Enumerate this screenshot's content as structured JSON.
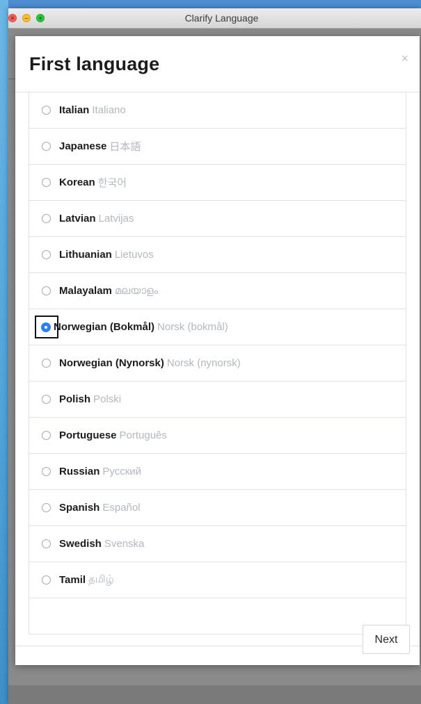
{
  "window": {
    "title": "Clarify Language",
    "traffic_glyphs": {
      "close": "×",
      "minimize": "–",
      "maximize": "+"
    }
  },
  "modal": {
    "title": "First language",
    "close_glyph": "×",
    "next_label": "Next"
  },
  "languages": [
    {
      "name": "Italian",
      "native": "Italiano",
      "selected": false
    },
    {
      "name": "Japanese",
      "native": "日本語",
      "selected": false
    },
    {
      "name": "Korean",
      "native": "한국어",
      "selected": false
    },
    {
      "name": "Latvian",
      "native": "Latvijas",
      "selected": false
    },
    {
      "name": "Lithuanian",
      "native": "Lietuvos",
      "selected": false
    },
    {
      "name": "Malayalam",
      "native": "മലയാളം",
      "selected": false
    },
    {
      "name": "Norwegian (Bokmål)",
      "native": "Norsk (bokmål)",
      "selected": true
    },
    {
      "name": "Norwegian (Nynorsk)",
      "native": "Norsk (nynorsk)",
      "selected": false
    },
    {
      "name": "Polish",
      "native": "Polski",
      "selected": false
    },
    {
      "name": "Portuguese",
      "native": "Português",
      "selected": false
    },
    {
      "name": "Russian",
      "native": "Русский",
      "selected": false
    },
    {
      "name": "Spanish",
      "native": "Español",
      "selected": false
    },
    {
      "name": "Swedish",
      "native": "Svenska",
      "selected": false
    },
    {
      "name": "Tamil",
      "native": "தமிழ்",
      "selected": false
    }
  ],
  "colors": {
    "accent": "#2f7ef5",
    "native_text": "#b3b8be",
    "divider": "#dfe3e8"
  }
}
